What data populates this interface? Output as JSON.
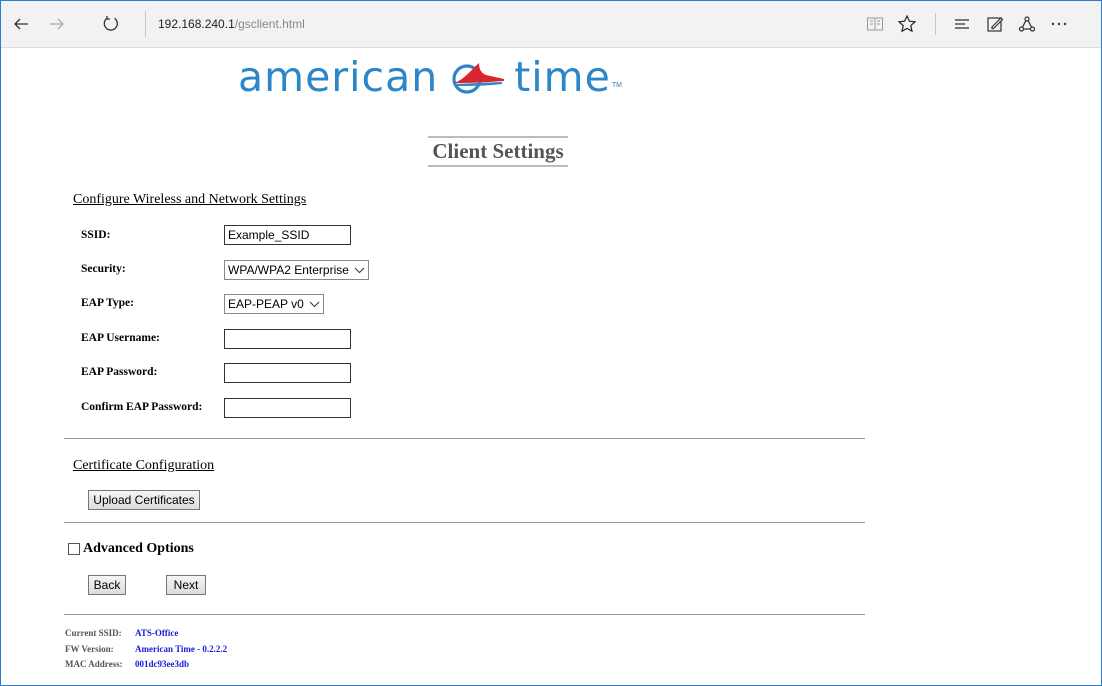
{
  "browser": {
    "url_host": "192.168.240.1",
    "url_path": "/gsclient.html",
    "icons": [
      "back-icon",
      "forward-icon",
      "refresh-icon",
      "reading-view-icon",
      "favorite-star-icon",
      "hub-icon",
      "web-note-icon",
      "share-icon",
      "more-icon"
    ]
  },
  "logo": {
    "word1": "american",
    "word2": "time",
    "trademark": "TM"
  },
  "page": {
    "title": "Client Settings"
  },
  "wireless": {
    "section_title": "Configure Wireless and Network Settings",
    "fields": {
      "ssid": {
        "label": "SSID:",
        "value": "Example_SSID"
      },
      "security": {
        "label": "Security:",
        "value": "WPA/WPA2 Enterprise"
      },
      "eap_type": {
        "label": "EAP Type:",
        "value": "EAP-PEAP v0"
      },
      "eap_username": {
        "label": "EAP Username:",
        "value": ""
      },
      "eap_password": {
        "label": "EAP Password:",
        "value": ""
      },
      "confirm_eap_password": {
        "label": "Confirm EAP Password:",
        "value": ""
      }
    }
  },
  "certificates": {
    "section_title": "Certificate Configuration",
    "upload_label": "Upload Certificates"
  },
  "advanced": {
    "label": "Advanced Options",
    "checked": false
  },
  "nav": {
    "back_label": "Back",
    "next_label": "Next"
  },
  "status": {
    "current_ssid": {
      "label": "Current SSID:",
      "value": "ATS-Office"
    },
    "fw_version": {
      "label": "FW Version:",
      "value": "American Time - 0.2.2.2"
    },
    "mac_address": {
      "label": "MAC Address:",
      "value": "001dc93ee3db"
    }
  },
  "colors": {
    "brand_blue": "#2c86c8",
    "brand_red": "#d9262e",
    "status_value": "#1a1adb"
  }
}
